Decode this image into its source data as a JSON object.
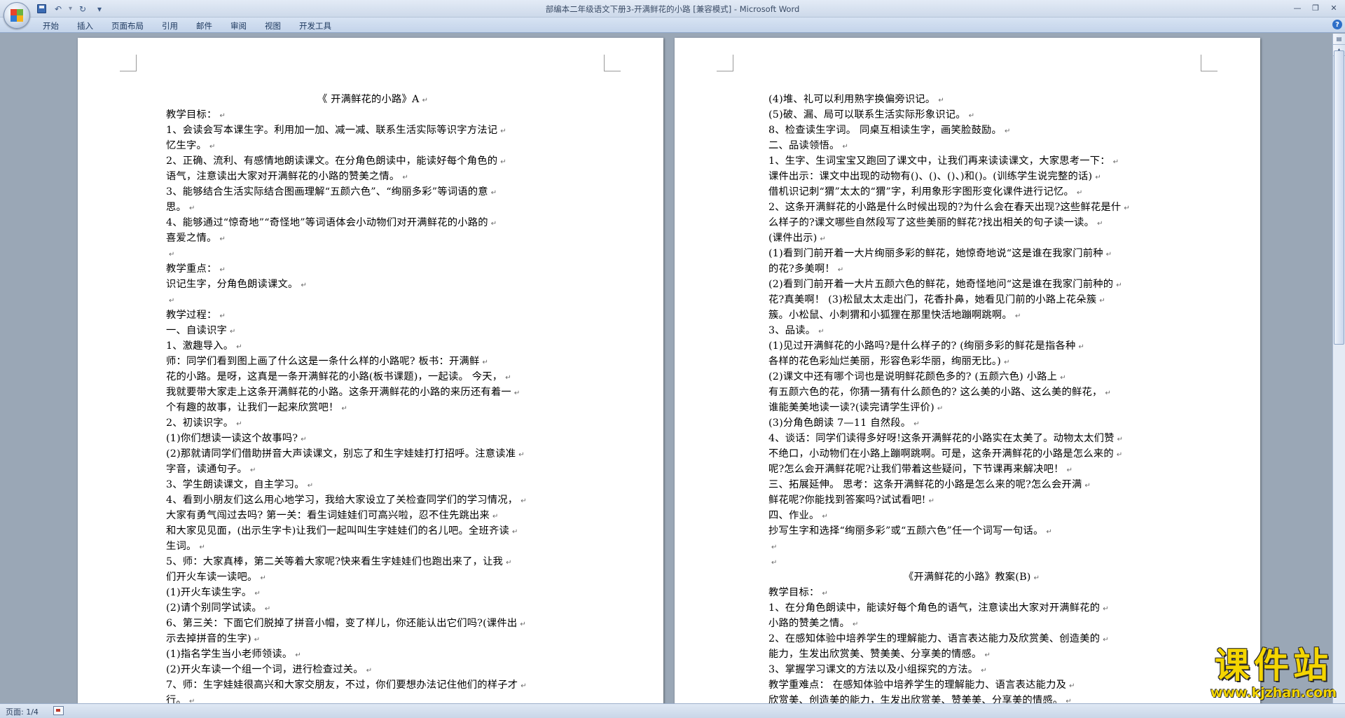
{
  "window": {
    "title": "部编本二年级语文下册3-开满鲜花的小路 [兼容模式] - Microsoft Word",
    "controls": [
      "—",
      "❐",
      "✕"
    ]
  },
  "quick_access": {
    "undo": "↶",
    "redo": "↻",
    "customize": "▾"
  },
  "ribbon": {
    "tabs": [
      "开始",
      "插入",
      "页面布局",
      "引用",
      "邮件",
      "审阅",
      "视图",
      "开发工具"
    ],
    "help": "?"
  },
  "status": {
    "page": "页面: 1/4"
  },
  "watermark": {
    "brand": "课件站",
    "url": "www.kjzhan.com"
  },
  "colors": {
    "ribbon_text": "#1f3a60",
    "watermark": "#f4d500",
    "workspace": "#9aa7b6"
  },
  "paragraph_mark": "↵",
  "page_left": [
    {
      "t": "《 开满鲜花的小路》A",
      "c": true
    },
    {
      "t": "教学目标："
    },
    {
      "t": "    1、会读会写本课生字。利用加一加、减一减、联系生活实际等识字方法记"
    },
    {
      "t": "忆生字。"
    },
    {
      "t": "    2、正确、流利、有感情地朗读课文。在分角色朗读中，能读好每个角色的"
    },
    {
      "t": "语气，注意读出大家对开满鲜花的小路的赞美之情。"
    },
    {
      "t": "    3、能够结合生活实际结合图画理解“五颜六色”、“绚丽多彩”等词语的意"
    },
    {
      "t": "思。"
    },
    {
      "t": "    4、能够通过“惊奇地”“奇怪地”等词语体会小动物们对开满鲜花的小路的"
    },
    {
      "t": " 喜爱之情。"
    },
    {
      "t": ""
    },
    {
      "t": "教学重点："
    },
    {
      "t": "识记生字，分角色朗读课文。"
    },
    {
      "t": ""
    },
    {
      "t": "教学过程："
    },
    {
      "t": "一、自读识字"
    },
    {
      "t": "1、激趣导入。"
    },
    {
      "t": "    师：同学们看到图上画了什么这是一条什么样的小路呢?        板书：开满鲜"
    },
    {
      "t": "花的小路。是呀，这真是一条开满鲜花的小路(板书课题)，一起读。        今天，"
    },
    {
      "t": "我就要带大家走上这条开满鲜花的小路。这条开满鲜花的小路的来历还有着一"
    },
    {
      "t": "个有趣的故事，让我们一起来欣赏吧！"
    },
    {
      "t": "2、初读识字。"
    },
    {
      "t": "(1)你们想读一读这个故事吗?"
    },
    {
      "t": "(2)那就请同学们借助拼音大声读课文，别忘了和生字娃娃打打招呼。注意读准"
    },
    {
      "t": "字音，读通句子。"
    },
    {
      "t": "3、学生朗读课文，自主学习。"
    },
    {
      "t": "4、看到小朋友们这么用心地学习，我给大家设立了关检查同学们的学习情况，"
    },
    {
      "t": "大家有勇气闯过去吗?        第一关：看生词娃娃们可高兴啦，忍不住先跳出来"
    },
    {
      "t": "和大家见见面，(出示生字卡)让我们一起叫叫生字娃娃们的名儿吧。全班齐读"
    },
    {
      "t": "生词。"
    },
    {
      "t": "    5、师：大家真棒，第二关等着大家呢?快来看生字娃娃们也跑出来了，让我"
    },
    {
      "t": "们开火车读一读吧。"
    },
    {
      "t": "  (1)开火车读生字。"
    },
    {
      "t": "  (2)请个别同学试读。"
    },
    {
      "t": "6、第三关：下面它们脱掉了拼音小帽，变了样儿，你还能认出它们吗?(课件出"
    },
    {
      "t": "示去掉拼音的生字)"
    },
    {
      "t": "(1)指名学生当小老师领读。"
    },
    {
      "t": "(2)开火车读一个组一个词，进行检查过关。"
    },
    {
      "t": "7、师：生字娃娃很高兴和大家交朋友，不过，你们要想办法记住他们的样子才"
    },
    {
      "t": "行。"
    }
  ],
  "page_right": [
    {
      "t": "  (4)堆、礼可以利用熟字换偏旁识记。"
    },
    {
      "t": "  (5)破、漏、局可以联系生活实际形象识记。"
    },
    {
      "t": "8、检查读生字词。        同桌互相读生字，画笑脸鼓励。"
    },
    {
      "t": "二、品读领悟。"
    },
    {
      "t": "1、生字、生词宝宝又跑回了课文中，让我们再来读读课文，大家思考一下："
    },
    {
      "t": "课件出示：课文中出现的动物有()、()、()、)和()。(训练学生说完整的话)"
    },
    {
      "t": "借机识记刺“猬”太太的“猬”字，利用象形字图形变化课件进行记忆。"
    },
    {
      "t": "2、这条开满鲜花的小路是什么时候出现的?为什么会在春天出现?这些鲜花是什"
    },
    {
      "t": "么样子的?课文哪些自然段写了这些美丽的鲜花?找出相关的句子读一读。"
    },
    {
      "t": "(课件出示)"
    },
    {
      "t": "  (1)看到门前开着一大片绚丽多彩的鲜花，她惊奇地说“这是谁在我家门前种"
    },
    {
      "t": "的花?多美啊！"
    },
    {
      "t": "(2)看到门前开着一大片五颜六色的鲜花，她奇怪地问“这是谁在我家门前种的"
    },
    {
      "t": "花?真美啊！        (3)松鼠太太走出门，花香扑鼻，她看见门前的小路上花朵簇"
    },
    {
      "t": "簇。小松鼠、小刺猬和小狐狸在那里快活地蹦啊跳啊。"
    },
    {
      "t": "3、品读。"
    },
    {
      "t": "  (1)见过开满鲜花的小路吗?是什么样子的?        (绚丽多彩的鲜花是指各种"
    },
    {
      "t": "各样的花色彩灿烂美丽，形容色彩华丽，绚丽无比。)"
    },
    {
      "t": " (2)课文中还有哪个词也是说明鲜花颜色多的?        (五颜六色)        小路上"
    },
    {
      "t": "有五颜六色的花，你猜一猜有什么颜色的?        这么美的小路、这么美的鲜花，"
    },
    {
      "t": "谁能美美地读一读?(读完请学生评价)"
    },
    {
      "t": "  (3)分角色朗读 7—11 自然段。"
    },
    {
      "t": "  4、谈话：同学们读得多好呀!这条开满鲜花的小路实在太美了。动物太太们赞"
    },
    {
      "t": "不绝口，小动物们在小路上蹦啊跳啊。可是，这条开满鲜花的小路是怎么来的"
    },
    {
      "t": "呢?怎么会开满鲜花呢?让我们带着这些疑问，下节课再来解决吧！"
    },
    {
      "t": "    三、拓展延伸。        思考：这条开满鲜花的小路是怎么来的呢?怎么会开满"
    },
    {
      "t": "鲜花呢?你能找到答案吗?试试看吧!"
    },
    {
      "t": "  四、作业。"
    },
    {
      "t": "    抄写生字和选择“绚丽多彩”或“五颜六色”任一个词写一句话。"
    },
    {
      "t": ""
    },
    {
      "t": ""
    },
    {
      "t": "《开满鲜花的小路》教案(B)",
      "c": true
    },
    {
      "t": "    教学目标："
    },
    {
      "t": "    1、在分角色朗读中，能读好每个角色的语气，注意读出大家对开满鲜花的"
    },
    {
      "t": "小路的赞美之情。"
    },
    {
      "t": "    2、在感知体验中培养学生的理解能力、语言表达能力及欣赏美、创造美的"
    },
    {
      "t": "能力，生发出欣赏美、赞美美、分享美的情感。"
    },
    {
      "t": "    3、掌握学习课文的方法以及小组探究的方法。"
    },
    {
      "t": "    教学重难点：        在感知体验中培养学生的理解能力、语言表达能力及"
    },
    {
      "t": "欣赏美、创造美的能力，生发出欣赏美、赞美美、分享美的情感。"
    }
  ]
}
